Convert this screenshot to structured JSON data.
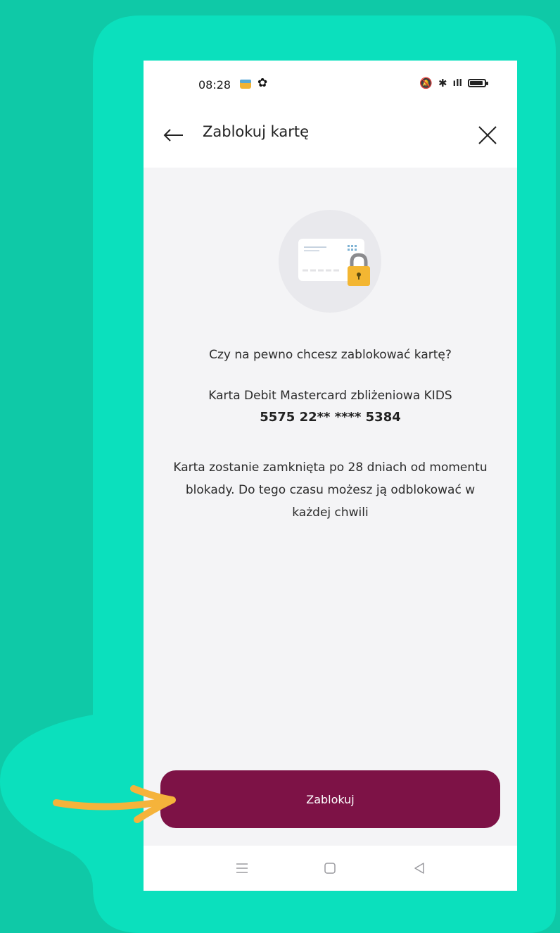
{
  "status_bar": {
    "time": "08:28"
  },
  "header": {
    "title": "Zablokuj kartę"
  },
  "content": {
    "question": "Czy na pewno chcesz zablokować kartę?",
    "card_name": "Karta Debit Mastercard zbliżeniowa KIDS",
    "card_number": "5575 22** **** 5384",
    "info": "Karta zostanie zamknięta po 28 dniach od momentu blokady. Do tego czasu możesz ją odblokować w każdej chwili"
  },
  "actions": {
    "block_button_label": "Zablokuj"
  },
  "colors": {
    "background": "#0fc9a7",
    "frame": "#0be0bd",
    "button": "#7d1246",
    "arrow": "#f5b33b"
  },
  "icons": {
    "back": "arrow-left-icon",
    "close": "close-icon",
    "card": "card-lock-icon",
    "nav_menu": "menu-icon",
    "nav_home": "square-icon",
    "nav_back": "triangle-back-icon"
  }
}
